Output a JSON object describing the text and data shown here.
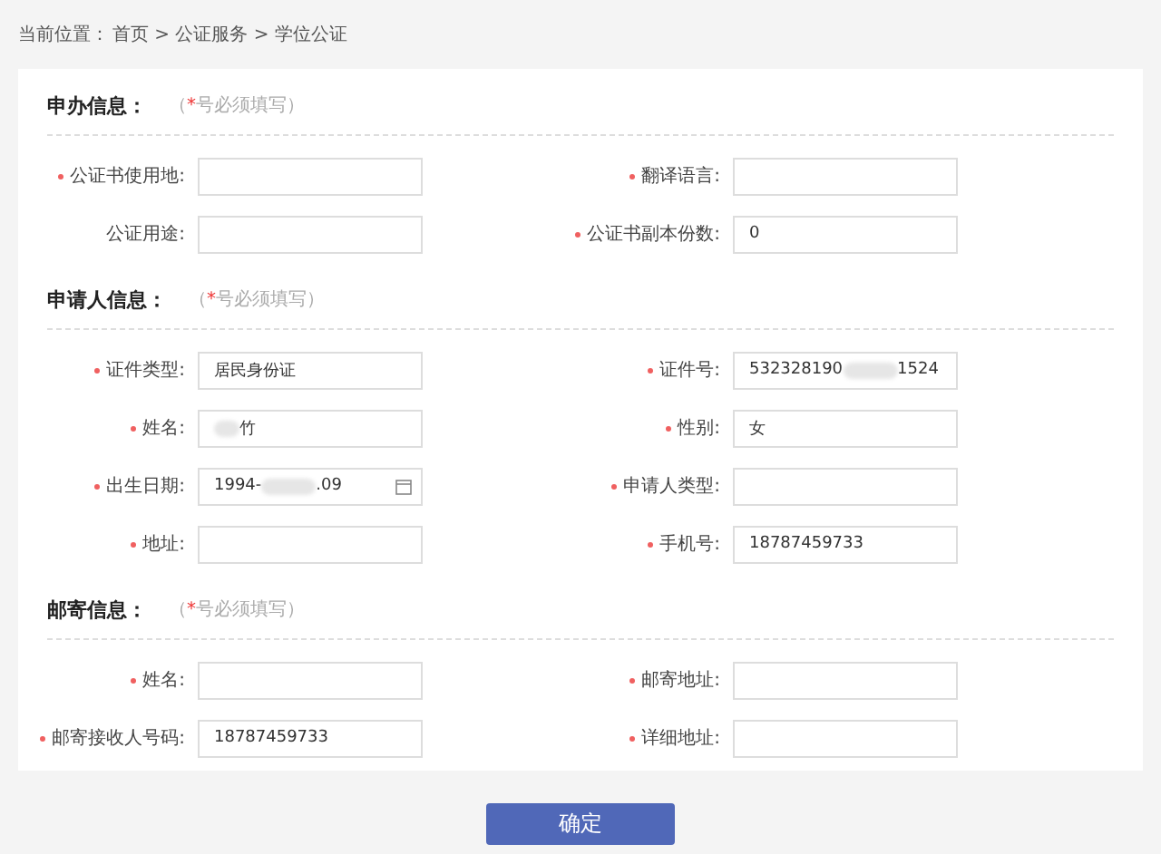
{
  "breadcrumb": {
    "label": "当前位置：",
    "path": "首页 > 公证服务 > 学位公证"
  },
  "sections": [
    {
      "title": "申办信息：",
      "hint_before": "（",
      "hint_mark": "*",
      "hint_after": "号必须填写）",
      "rows": [
        [
          {
            "label": "公证书使用地:",
            "required": true,
            "kind": "text"
          },
          {
            "label": "翻译语言:",
            "required": true,
            "kind": "text"
          }
        ],
        [
          {
            "label": "公证用途:",
            "required": false,
            "kind": "text"
          },
          {
            "label": "公证书副本份数:",
            "required": true,
            "kind": "text",
            "value": "0"
          }
        ]
      ]
    },
    {
      "title": "申请人信息：",
      "hint_before": "（",
      "hint_mark": "*",
      "hint_after": "号必须填写）",
      "rows": [
        [
          {
            "label": "证件类型:",
            "required": true,
            "kind": "text",
            "value": "居民身份证"
          },
          {
            "label": "证件号:",
            "required": true,
            "kind": "text",
            "value": "532328190",
            "value_end": "1524",
            "redacted": true
          }
        ],
        [
          {
            "label": "姓名:",
            "required": true,
            "kind": "text",
            "value": "竹",
            "redacted": true,
            "redact_first": true
          },
          {
            "label": "性别:",
            "required": true,
            "kind": "text",
            "value": "女"
          }
        ],
        [
          {
            "label": "出生日期:",
            "required": true,
            "kind": "date",
            "value": "1994-",
            "value_end": ".09",
            "redacted": true
          },
          {
            "label": "申请人类型:",
            "required": true,
            "kind": "text"
          }
        ],
        [
          {
            "label": "地址:",
            "required": true,
            "kind": "text"
          },
          {
            "label": "手机号:",
            "required": true,
            "kind": "text",
            "value": "18787459733"
          }
        ]
      ]
    },
    {
      "title": "邮寄信息：",
      "hint_before": "（",
      "hint_mark": "*",
      "hint_after": "号必须填写）",
      "rows": [
        [
          {
            "label": "姓名:",
            "required": true,
            "kind": "text"
          },
          {
            "label": "邮寄地址:",
            "required": true,
            "kind": "text"
          }
        ],
        [
          {
            "label": "邮寄接收人号码:",
            "required": true,
            "kind": "text",
            "value": "18787459733"
          },
          {
            "label": "详细地址:",
            "required": true,
            "kind": "text"
          }
        ]
      ]
    }
  ],
  "submit_button": "确定"
}
